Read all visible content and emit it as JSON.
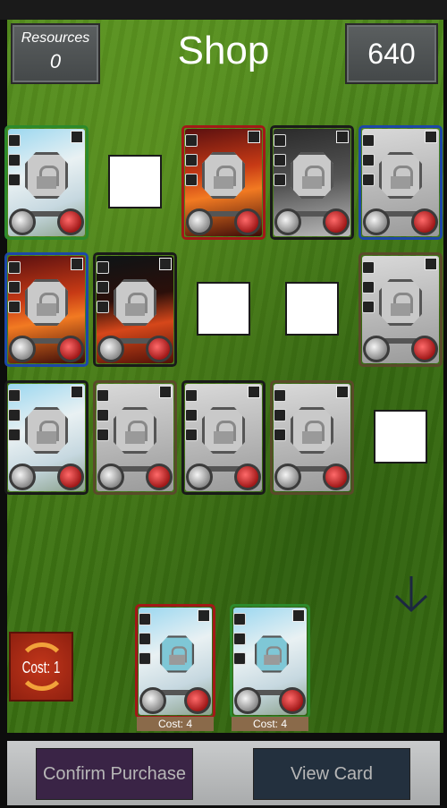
{
  "header": {
    "resources_label": "Resources",
    "resources_value": "0",
    "title": "Shop",
    "currency": "640"
  },
  "shop_cards": [
    {
      "row": 1,
      "col": 1,
      "art": "blue",
      "frame": "green"
    },
    {
      "row": 1,
      "col": 3,
      "art": "fire",
      "frame": "red"
    },
    {
      "row": 1,
      "col": 4,
      "art": "dark",
      "frame": "black"
    },
    {
      "row": 1,
      "col": 5,
      "art": "grey",
      "frame": "blue"
    },
    {
      "row": 2,
      "col": 1,
      "art": "fire",
      "frame": "blue"
    },
    {
      "row": 2,
      "col": 2,
      "art": "firedark",
      "frame": "black"
    },
    {
      "row": 2,
      "col": 5,
      "art": "grey",
      "frame": "olive"
    },
    {
      "row": 3,
      "col": 1,
      "art": "blue",
      "frame": "black"
    },
    {
      "row": 3,
      "col": 2,
      "art": "grey",
      "frame": "olive"
    },
    {
      "row": 3,
      "col": 3,
      "art": "grey",
      "frame": "black"
    },
    {
      "row": 3,
      "col": 4,
      "art": "grey",
      "frame": "olive"
    }
  ],
  "selected_cards": [
    {
      "cost_label": "Cost: 4",
      "art": "blue",
      "frame": "red"
    },
    {
      "cost_label": "Cost: 4",
      "art": "blue",
      "frame": "green"
    }
  ],
  "refresh": {
    "label": "Cost: 1",
    "icon": "cycle-arrows-icon"
  },
  "scroll_icon": "arrow-down-icon",
  "buttons": {
    "confirm": "Confirm Purchase",
    "view": "View Card"
  }
}
